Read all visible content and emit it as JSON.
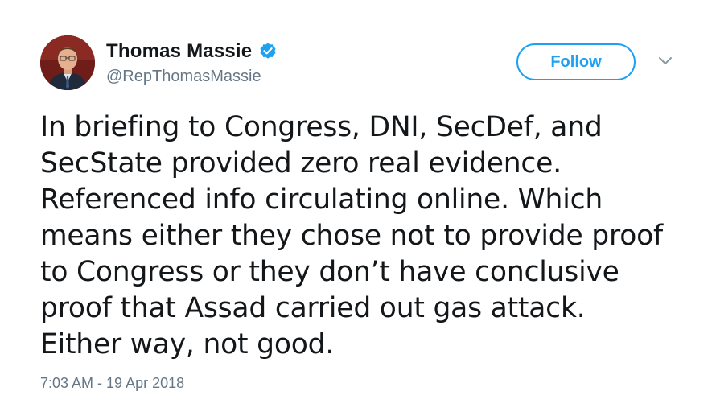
{
  "author": {
    "display_name": "Thomas Massie",
    "handle": "@RepThomasMassie",
    "avatar_icon": "profile-photo",
    "verified_icon": "verified-badge-icon"
  },
  "actions": {
    "follow_label": "Follow",
    "more_icon": "chevron-down-icon"
  },
  "tweet": {
    "text": "In briefing to Congress, DNI, SecDef, and\nSecState provided zero real evidence.\nReferenced info circulating online. Which\nmeans either they chose not to provide proof\nto Congress or they don’t have conclusive\nproof that Assad carried out gas attack.\nEither way, not good.",
    "timestamp": "7:03 AM - 19 Apr 2018"
  },
  "colors": {
    "accent": "#1da1f2",
    "text": "#14171a",
    "muted": "#657786"
  }
}
